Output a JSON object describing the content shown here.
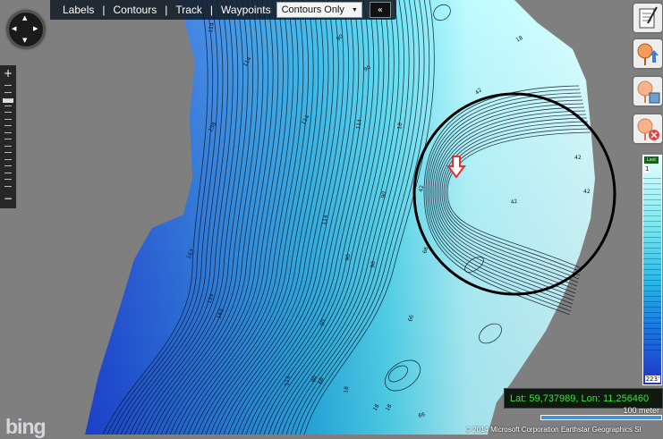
{
  "topbar": {
    "labels": "Labels",
    "contours": "Contours",
    "track": "Track",
    "waypoints": "Waypoints",
    "view_select": "Contours Only",
    "collapse_glyph": "«"
  },
  "zoom": {
    "in": "+",
    "out": "−"
  },
  "depth_legend": {
    "tag": "Last",
    "min_label": "1",
    "max_label": "223'"
  },
  "contour_labels": [
    "114",
    "114",
    "114",
    "114",
    "114",
    "138",
    "163",
    "163",
    "114",
    "114",
    "90",
    "90",
    "90",
    "90",
    "90",
    "90",
    "90",
    "66",
    "66",
    "66",
    "66",
    "42",
    "42",
    "42",
    "42",
    "42",
    "18",
    "18",
    "18",
    "18",
    "18"
  ],
  "position": "Lat: 59,737989, Lon: 11,256460",
  "scale": {
    "label": "100 meter"
  },
  "copyright": "© 2014 Microsoft Corporation   Earthstar Geographics  SI",
  "logo": "bing",
  "colors": {
    "deep": "#2233c8",
    "mid": "#2aa8e0",
    "shallow": "#c8fbff",
    "land": "#7f7f7f",
    "highlight_circle": "#000000",
    "marker": "#e03030"
  }
}
